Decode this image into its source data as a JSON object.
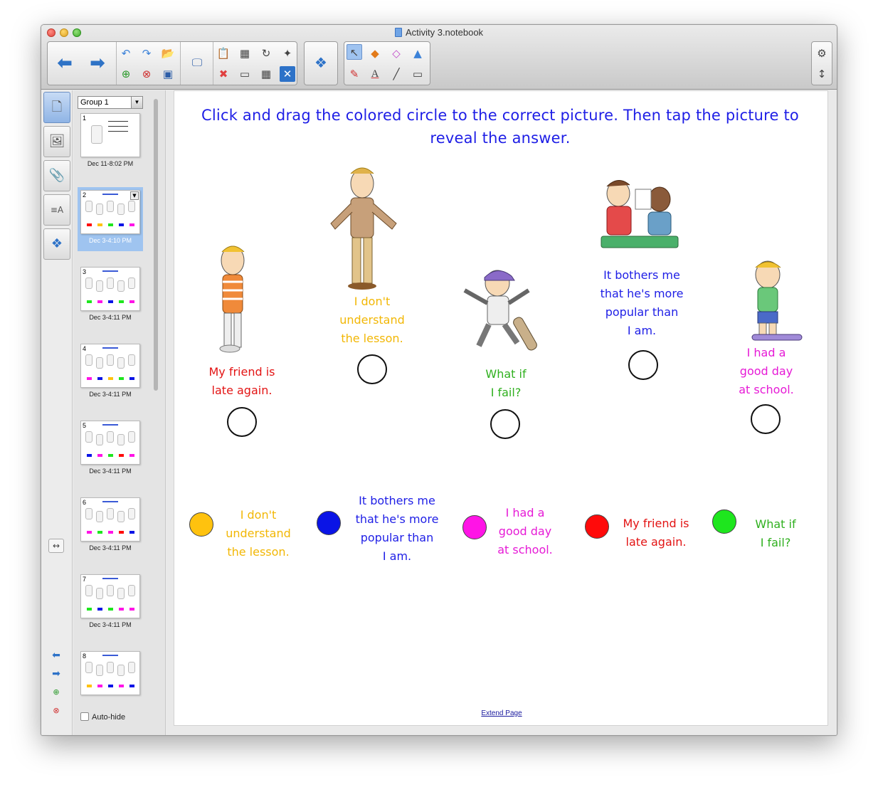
{
  "window": {
    "title": "Activity 3.notebook"
  },
  "toolbar": {
    "icons": [
      "back-arrow-icon",
      "forward-arrow-icon",
      "undo-icon",
      "redo-icon",
      "open-icon",
      "new-page-icon",
      "delete-page-icon",
      "save-icon",
      "screen-shade-icon",
      "paste-icon",
      "screen-capture-icon",
      "rotate-icon",
      "magic-pen-icon",
      "delete-icon",
      "fullscreen-icon",
      "table-icon",
      "clear-icon",
      "add-ons-icon",
      "select-icon",
      "shapes-icon",
      "eraser-icon",
      "fill-icon",
      "pens-icon",
      "text-icon",
      "line-icon",
      "eraser2-icon",
      "gear-icon",
      "expand-icon"
    ]
  },
  "sorter": {
    "group_label": "Group 1",
    "autohide_label": "Auto-hide",
    "pages": [
      {
        "num": "1",
        "date": "Dec 11-8:02 PM"
      },
      {
        "num": "2",
        "date": "Dec 3-4:10 PM"
      },
      {
        "num": "3",
        "date": "Dec 3-4:11 PM"
      },
      {
        "num": "4",
        "date": "Dec 3-4:11 PM"
      },
      {
        "num": "5",
        "date": "Dec 3-4:11 PM"
      },
      {
        "num": "6",
        "date": "Dec 3-4:11 PM"
      },
      {
        "num": "7",
        "date": "Dec 3-4:11 PM"
      },
      {
        "num": "8",
        "date": ""
      }
    ]
  },
  "page": {
    "instruction_line1": "Click and drag the colored circle to the correct picture.  Then tap the picture to",
    "instruction_line2": "reveal the answer.",
    "characters": [
      {
        "label_lines": [
          "My friend is",
          "late again."
        ],
        "color": "#e31414"
      },
      {
        "label_lines": [
          "I don't",
          "understand",
          "the lesson."
        ],
        "color": "#f2b705"
      },
      {
        "label_lines": [
          "What if",
          "I fail?"
        ],
        "color": "#2fb01e"
      },
      {
        "label_lines": [
          "It bothers me",
          "that he's more",
          "popular than",
          "I am."
        ],
        "color": "#1e1ee6"
      },
      {
        "label_lines": [
          "I had a",
          "good day",
          "at school."
        ],
        "color": "#e61ad6"
      }
    ],
    "answers": [
      {
        "dot_color": "#ffc20e",
        "lines": [
          "I don't",
          "understand",
          "the lesson."
        ],
        "color": "#f2b705"
      },
      {
        "dot_color": "#0a14e6",
        "lines": [
          "It bothers me",
          "that he's more",
          "popular than",
          "I am."
        ],
        "color": "#1e1ee6"
      },
      {
        "dot_color": "#ff14e6",
        "lines": [
          "I had a",
          "good day",
          "at school."
        ],
        "color": "#e61ad6"
      },
      {
        "dot_color": "#ff0a0a",
        "lines": [
          "My friend is",
          "late again."
        ],
        "color": "#e31414"
      },
      {
        "dot_color": "#1ee61e",
        "lines": [
          "What if",
          "I fail?"
        ],
        "color": "#2fb01e"
      }
    ],
    "extend_link": "Extend Page"
  }
}
